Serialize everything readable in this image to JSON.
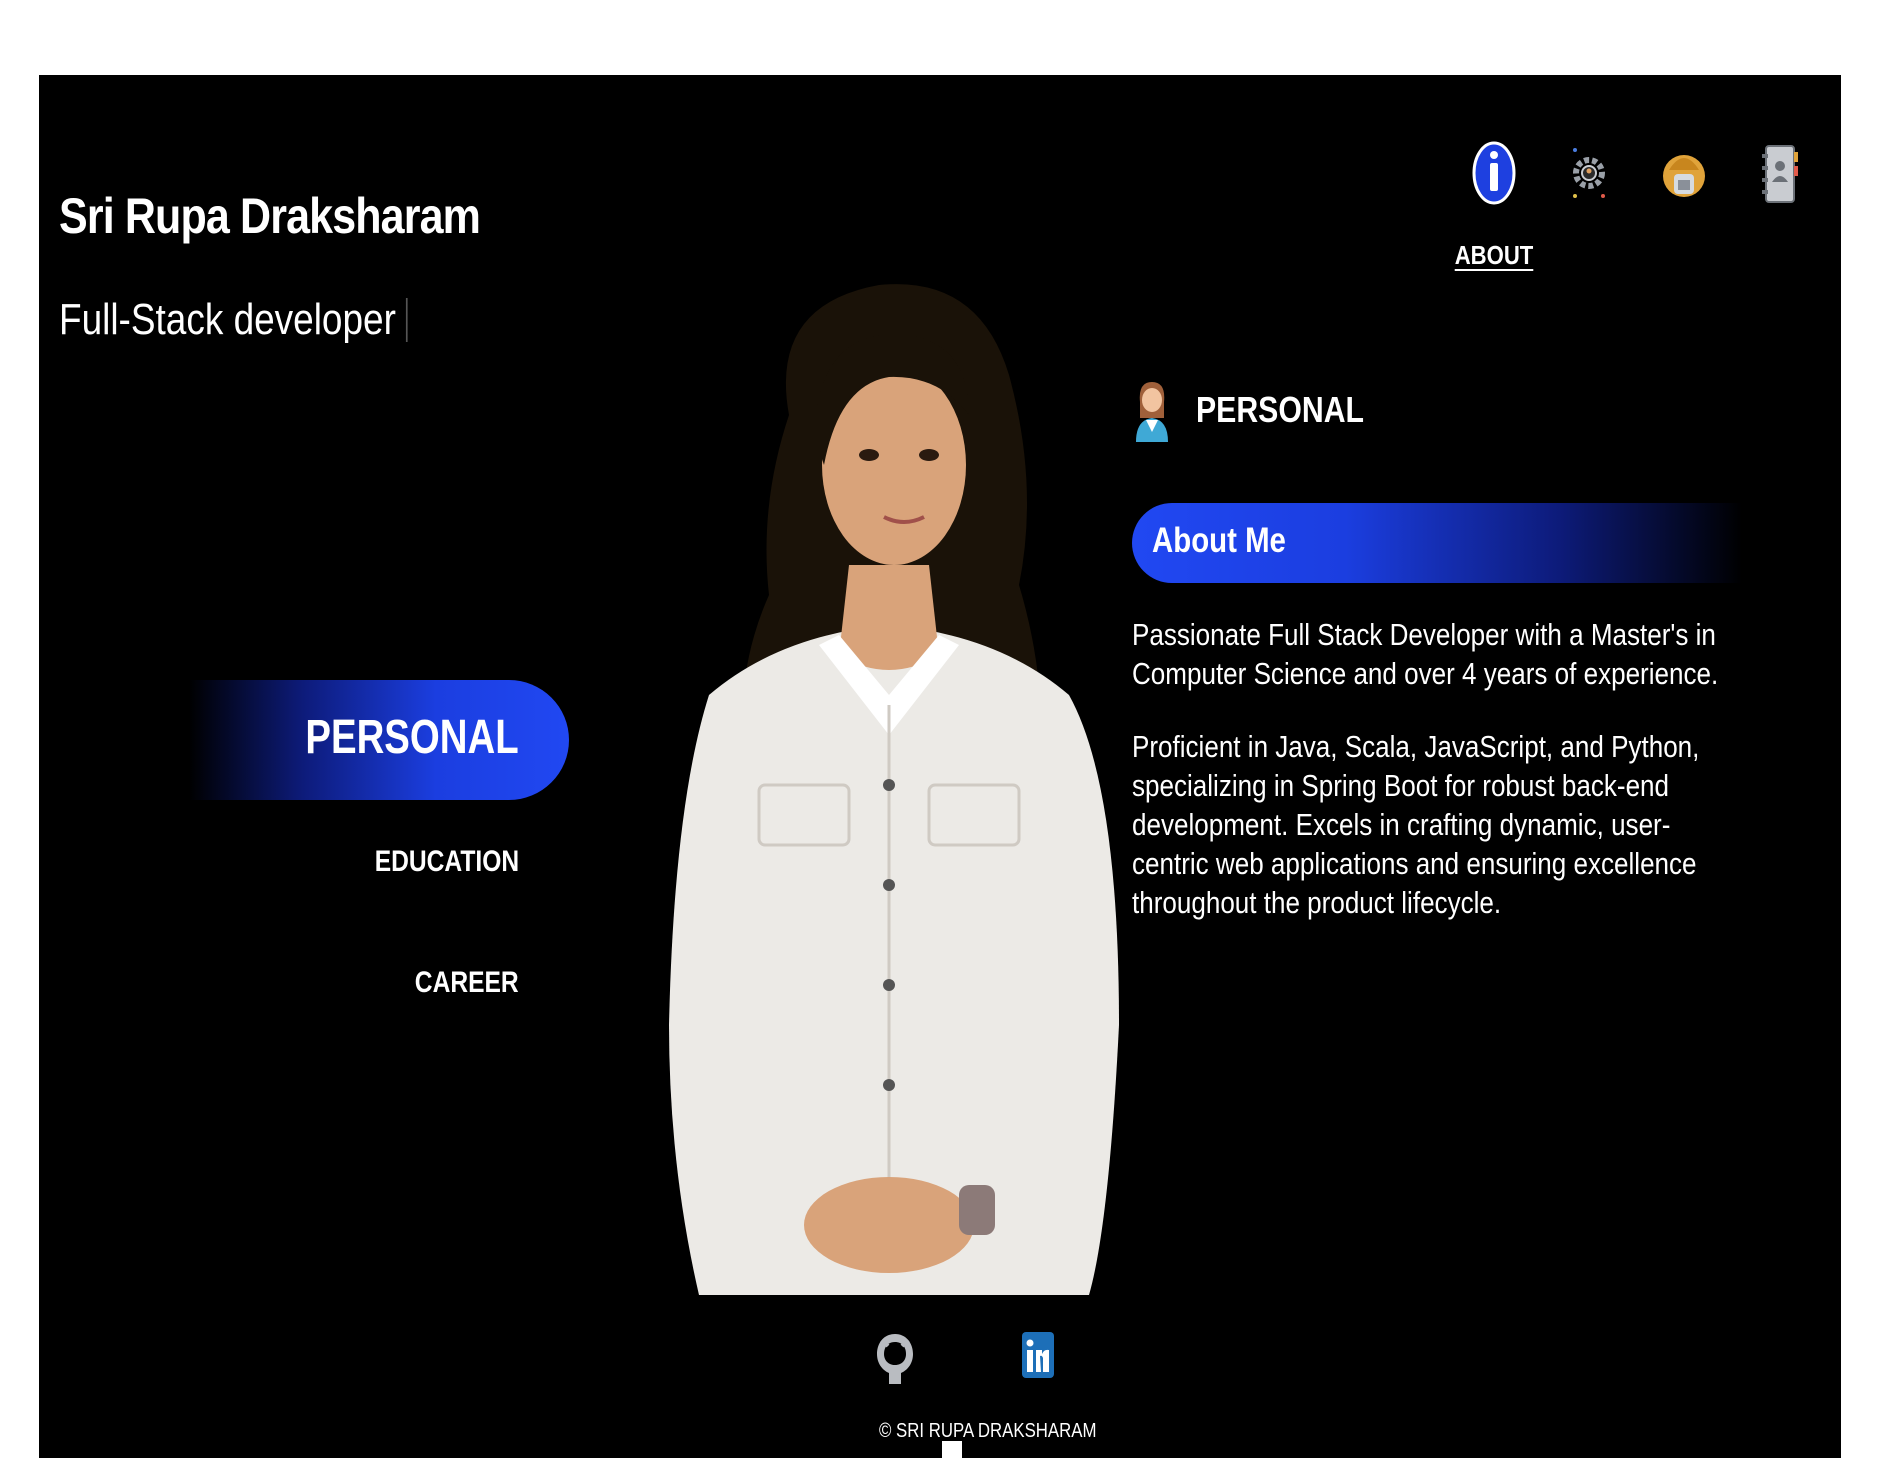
{
  "header": {
    "name": "Sri Rupa Draksharam",
    "role": "Full-Stack developer"
  },
  "topnav": {
    "items": [
      {
        "label": "ABOUT",
        "icon": "info-icon",
        "active": true
      },
      {
        "label": "",
        "icon": "gear-icon"
      },
      {
        "label": "",
        "icon": "worker-icon"
      },
      {
        "label": "",
        "icon": "contact-book-icon"
      }
    ]
  },
  "section_menu": {
    "items": [
      {
        "label": "PERSONAL",
        "active": true
      },
      {
        "label": "EDUCATION"
      },
      {
        "label": "CAREER"
      }
    ]
  },
  "content": {
    "heading": "PERSONAL",
    "about_title": "About Me",
    "paragraphs": [
      "Passionate Full Stack Developer with a Master's in Computer Science and over 4 years of experience.",
      "Proficient in Java, Scala, JavaScript, and Python, specializing in Spring Boot for robust back-end development. Excels in crafting dynamic, user-centric web applications and ensuring excellence throughout the product lifecycle."
    ]
  },
  "footer": {
    "social": [
      {
        "icon": "github-icon"
      },
      {
        "icon": "linkedin-icon"
      }
    ],
    "copyright": "© SRI RUPA DRAKSHARAM"
  },
  "colors": {
    "background": "#000000",
    "accent": "#2148f2",
    "text": "#ffffff"
  }
}
